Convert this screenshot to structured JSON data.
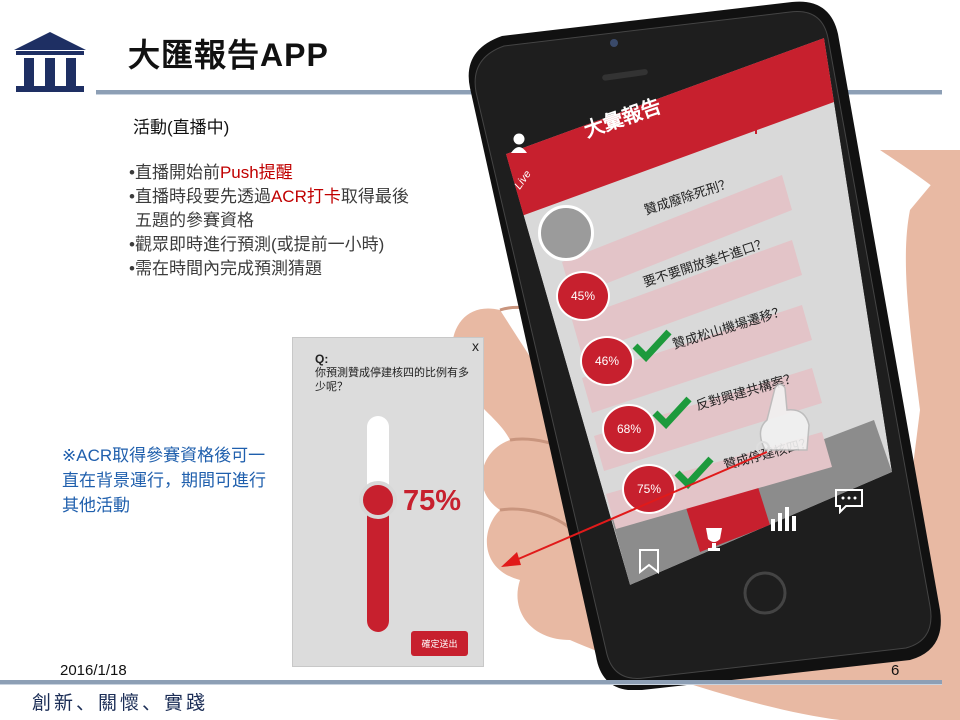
{
  "header": {
    "title": "大匯報告APP",
    "logo_icon": "pillar-building-icon"
  },
  "content": {
    "activity_heading": "活動(直播中)",
    "bullets": [
      {
        "prefix": "•直播開始前",
        "highlight": "Push提醒",
        "suffix": ""
      },
      {
        "prefix": "•直播時段要先透過",
        "highlight": "ACR打卡",
        "suffix": "取得最後"
      },
      {
        "prefix": " 五題的參賽資格",
        "highlight": "",
        "suffix": ""
      },
      {
        "prefix": "•觀眾即時進行預測(或提前一小時)",
        "highlight": "",
        "suffix": ""
      },
      {
        "prefix": "•需在時間內完成預測猜題",
        "highlight": "",
        "suffix": ""
      }
    ],
    "acr_note": "※ACR取得參賽資格後可一直在背景運行，期間可進行其他活動"
  },
  "popup": {
    "q_label": "Q:",
    "question": "你預測贊成停建核四的比例有多少呢？",
    "percent": "75%",
    "percent_value": 75,
    "close": "x",
    "submit": "確定送出"
  },
  "app": {
    "title": "大彙報告",
    "live_badge": "Live",
    "questions": [
      {
        "text": "贊成廢除死刑？",
        "percent": "",
        "checked": false
      },
      {
        "text": "要不要開放美牛進口？",
        "percent": "45%",
        "checked": false
      },
      {
        "text": "贊成松山機場遷移？",
        "percent": "46%",
        "checked": true
      },
      {
        "text": "反對興建共構案？",
        "percent": "68%",
        "checked": true
      },
      {
        "text": "贊成停建核四？",
        "percent": "75%",
        "checked": true
      }
    ],
    "tabs": [
      "bookmark-icon",
      "trophy-icon",
      "bar-chart-icon",
      "chat-icon"
    ]
  },
  "footer": {
    "date": "2016/1/18",
    "page": "6",
    "motto": "創新、關懷、實踐"
  },
  "colors": {
    "accent": "#c7202e",
    "rule": "#8d9fb5",
    "note": "#1f5fad",
    "check": "#1d9a3c"
  }
}
